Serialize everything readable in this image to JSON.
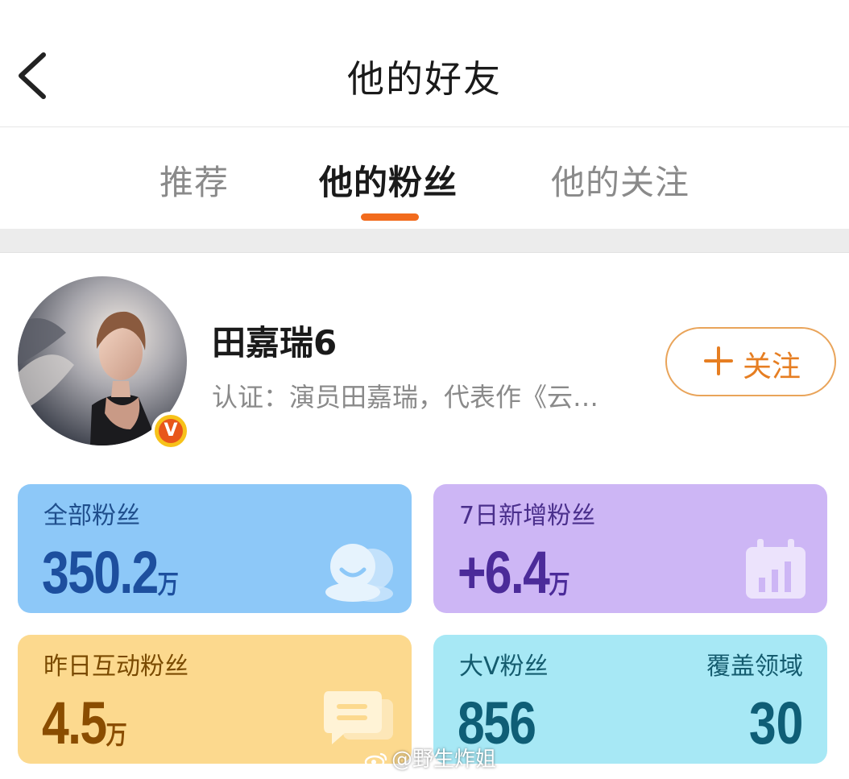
{
  "header": {
    "title": "他的好友"
  },
  "tabs": [
    {
      "label": "推荐",
      "active": false
    },
    {
      "label": "他的粉丝",
      "active": true
    },
    {
      "label": "他的关注",
      "active": false
    }
  ],
  "colors": {
    "accent": "#f26b1d",
    "follow": "#e67e22"
  },
  "user": {
    "name": "田嘉瑞6",
    "verification": "认证：演员田嘉瑞，代表作《云…",
    "badge": "V",
    "follow_label": "关注"
  },
  "stats": {
    "total_fans": {
      "label": "全部粉丝",
      "value": "350.2",
      "unit": "万"
    },
    "new_fans_7d": {
      "label": "7日新增粉丝",
      "value": "+6.4",
      "unit": "万"
    },
    "active_fans_yesterday": {
      "label": "昨日互动粉丝",
      "value": "4.5",
      "unit": "万"
    },
    "bigv_fans": {
      "label": "大V粉丝",
      "value": "856",
      "label2": "覆盖领域",
      "value2": "30"
    }
  },
  "watermark": "@野生炸姐"
}
